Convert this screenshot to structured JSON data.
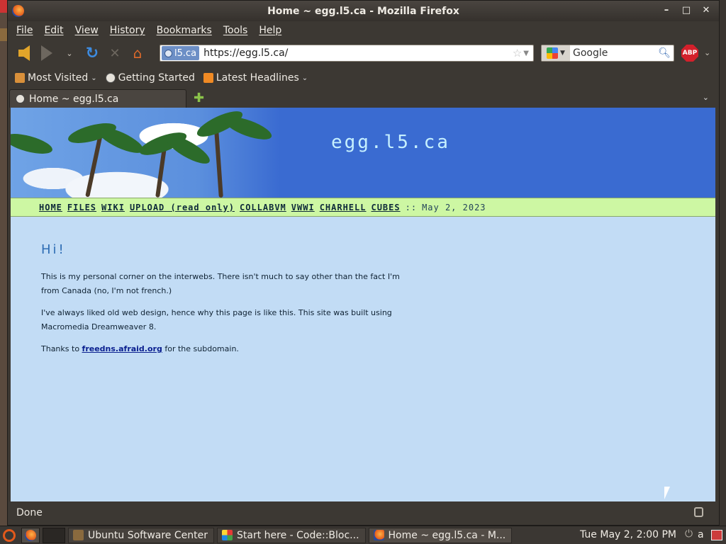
{
  "window": {
    "title": "Home ~ egg.l5.ca - Mozilla Firefox"
  },
  "menu": [
    "File",
    "Edit",
    "View",
    "History",
    "Bookmarks",
    "Tools",
    "Help"
  ],
  "navbar": {
    "site_identity": "l5.ca",
    "url": "https://egg.l5.ca/",
    "search_engine_placeholder": "Google"
  },
  "bookmarks": {
    "most_visited": "Most Visited",
    "getting_started": "Getting Started",
    "latest_headlines": "Latest Headlines"
  },
  "tab": {
    "label": "Home ~ egg.l5.ca"
  },
  "page": {
    "site_title": "egg.l5.ca",
    "nav_links": [
      "HOME",
      "FILES",
      "WIKI",
      "UPLOAD (read only)",
      "COLLABVM",
      "VWWI",
      "CHARHELL",
      "CUBES"
    ],
    "nav_separator": "::",
    "date": "May 2, 2023",
    "heading": "Hi!",
    "para1": "This is my personal corner on the interwebs. There isn't much to say other than the fact I'm from Canada (no, I'm not french.)",
    "para2": "I've always liked old web design, hence why this page is like this. This site was built using Macromedia Dreamweaver 8.",
    "para3_prefix": "Thanks to",
    "para3_link": "freedns.afraid.org",
    "para3_suffix": "for the subdomain."
  },
  "status": {
    "text": "Done"
  },
  "taskbar": {
    "tasks": [
      "Ubuntu Software Center",
      "Start here - Code::Bloc...",
      "Home ~ egg.l5.ca - M..."
    ],
    "clock": "Tue May  2, 2:00 PM",
    "user": "a"
  },
  "colors": {
    "page_bg": "#c2dcf5",
    "nav_bg": "#cdf7a3",
    "banner_bg": "#3a6bd1",
    "heading": "#2e6db4",
    "link": "#0a1f8f"
  }
}
